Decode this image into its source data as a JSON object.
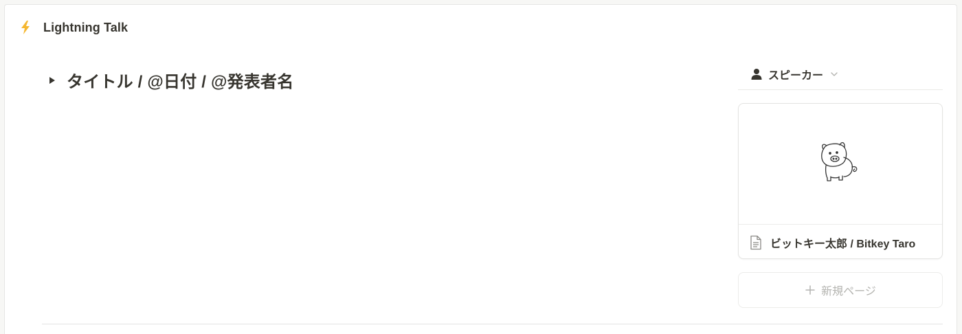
{
  "header": {
    "icon": "lightning-bolt-icon",
    "title": "Lightning Talk"
  },
  "toggle": {
    "title": "タイトル / @日付 / @発表者名",
    "expanded": false
  },
  "board": {
    "group_property": {
      "icon": "person-icon",
      "label": "スピーカー"
    },
    "cards": [
      {
        "cover": "pig-doodle-image",
        "icon": "document-icon",
        "title": "ビットキー太郎 / Bitkey Taro"
      }
    ],
    "new_page_label": "新規ページ"
  },
  "colors": {
    "accent_bolt": "#f5b731",
    "text": "#37352f",
    "muted": "#b4b4b0",
    "border": "#e3e3e1"
  }
}
